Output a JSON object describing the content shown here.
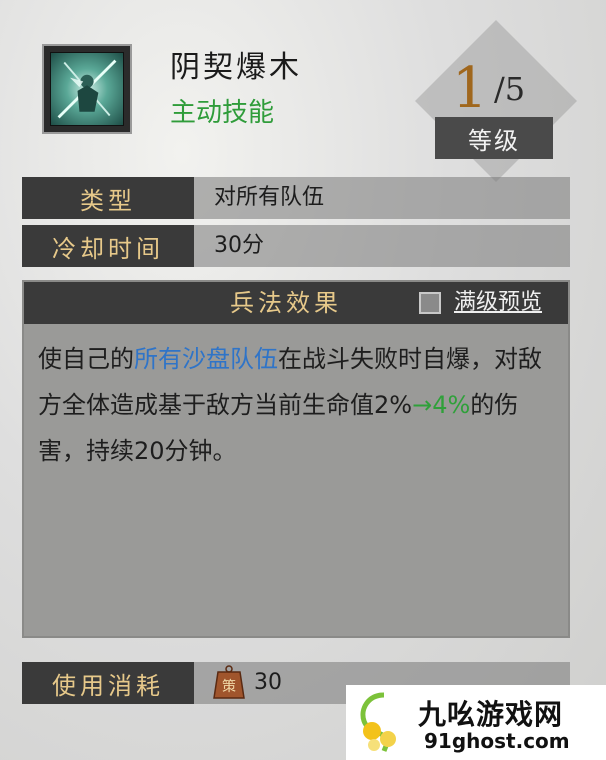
{
  "skill": {
    "name": "阴契爆木",
    "kind": "主动技能",
    "icon": "skill-icon"
  },
  "level": {
    "current": "1",
    "max": "/5",
    "label": "等级"
  },
  "info": {
    "type_label": "类型",
    "type_value": "对所有队伍",
    "cooldown_label": "冷却时间",
    "cooldown_value": "30分"
  },
  "effect": {
    "title": "兵法效果",
    "preview_label": "满级预览",
    "text_part1": "使自己的",
    "text_highlight": "所有沙盘队伍",
    "text_part2": "在战斗失败时自爆，对敌方全体造成基于敌方当前生命值2%",
    "text_arrow": "→4%",
    "text_part3": "的伤害，持续20分钟。"
  },
  "cost": {
    "label": "使用消耗",
    "token_char": "策",
    "value": "30"
  },
  "watermark": {
    "title": "九吆游戏网",
    "url": "91ghost.com"
  },
  "colors": {
    "accent_gold": "#e7c98a",
    "green": "#2f9c3a",
    "blue": "#2f74c8",
    "level_num": "#a0671d"
  }
}
